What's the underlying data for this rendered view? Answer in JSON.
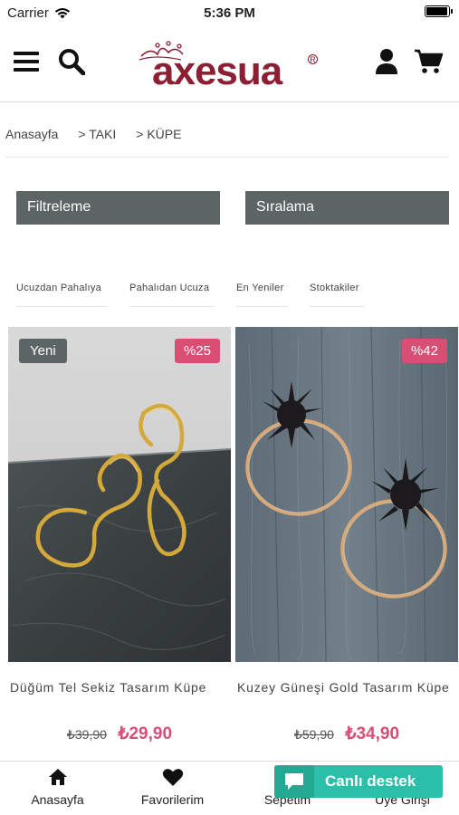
{
  "status": {
    "carrier": "Carrier",
    "time": "5:36 PM"
  },
  "header": {
    "logo": "axesua"
  },
  "breadcrumb": [
    "Anasayfa",
    "> TAKI",
    "> KÜPE"
  ],
  "buttons": {
    "filter": "Filtreleme",
    "sort": "Sıralama"
  },
  "sort_options": [
    "Ucuzdan Pahalıya",
    "Pahalıdan Ucuza",
    "En Yeniler",
    "Stoktakiler"
  ],
  "products": [
    {
      "badge_new": "Yeni",
      "discount": "%25",
      "name": "Düğüm Tel Sekiz Tasarım Küpe",
      "old_price": "₺39,90",
      "new_price": "₺29,90"
    },
    {
      "badge_new": "",
      "discount": "%42",
      "name": "Kuzey Güneşi Gold Tasarım Küpe",
      "old_price": "₺59,90",
      "new_price": "₺34,90"
    }
  ],
  "tabbar": [
    "Anasayfa",
    "Favorilerim",
    "Sepetim",
    "Üye Girişi"
  ],
  "live_chat": "Canlı destek",
  "colors": {
    "brand": "#8c1f34",
    "accent": "#d94f74",
    "button": "#5c6464",
    "chat": "#2bbfa9"
  }
}
